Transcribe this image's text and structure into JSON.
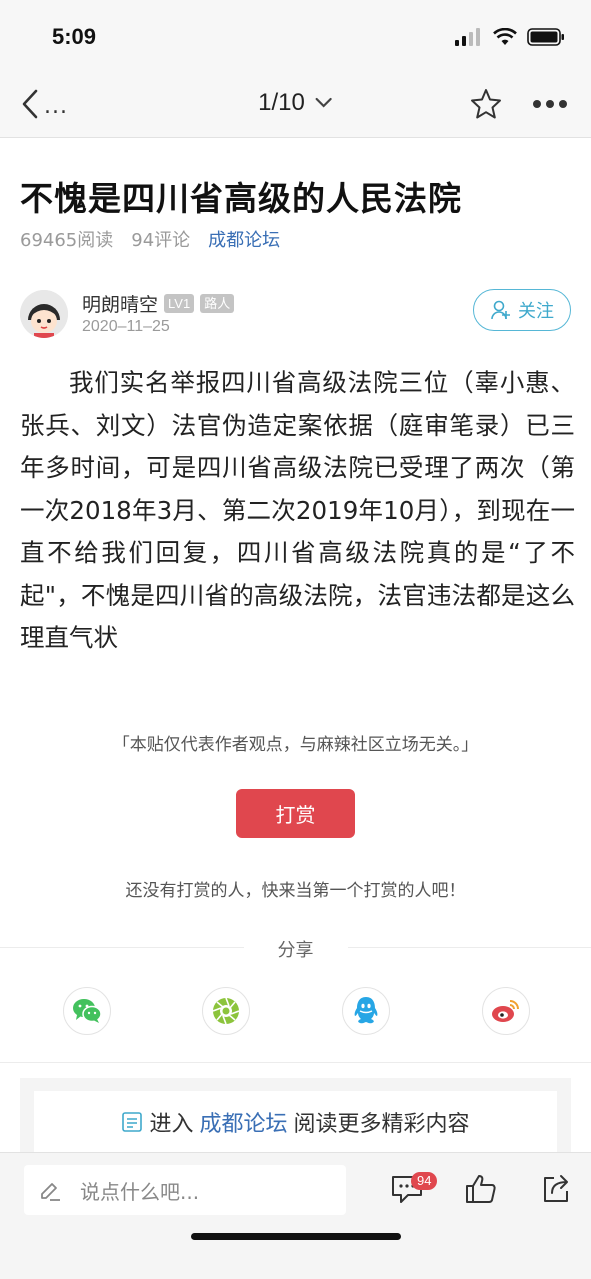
{
  "status_bar": {
    "time": "5:09"
  },
  "nav": {
    "back_text": "...",
    "pager": "1/10"
  },
  "post": {
    "title": "不愧是四川省高级的人民法院",
    "reads": "69465阅读",
    "comments": "94评论",
    "forum": "成都论坛",
    "author": {
      "name": "明朗晴空",
      "level": "LV1",
      "role": "路人",
      "date": "2020–11–25"
    },
    "follow_label": "关注",
    "body": "我们实名举报四川省高级法院三位（辜小惠、张兵、刘文）法官伪造定案依据（庭审笔录）已三年多时间，可是四川省高级法院已受理了两次（第一次2018年3月、第二次2019年10月），到现在一直不给我们回复，四川省高级法院真的是“了不起\"，不愧是四川省的高级法院，法官违法都是这么理直气状",
    "disclaimer": "「本贴仅代表作者观点，与麻辣社区立场无关。」"
  },
  "reward": {
    "button_label": "打赏",
    "hint": "还没有打赏的人，快来当第一个打赏的人吧！"
  },
  "share": {
    "label": "分享",
    "icons": [
      "wechat-icon",
      "moments-icon",
      "qq-icon",
      "weibo-icon"
    ],
    "colors": {
      "wechat": "#43c15d",
      "moments": "#8cc43c",
      "qq": "#27a6e5",
      "weibo": "#e0474e"
    }
  },
  "forum_card": {
    "prefix": "进入",
    "forum": "成都论坛",
    "suffix": "阅读更多精彩内容"
  },
  "bottom_bar": {
    "placeholder": "说点什么吧...",
    "comment_count": "94"
  },
  "colors": {
    "accent_blue": "#3a6fb5",
    "reward_red": "#e0474e",
    "follow_blue": "#3fa9cc"
  }
}
